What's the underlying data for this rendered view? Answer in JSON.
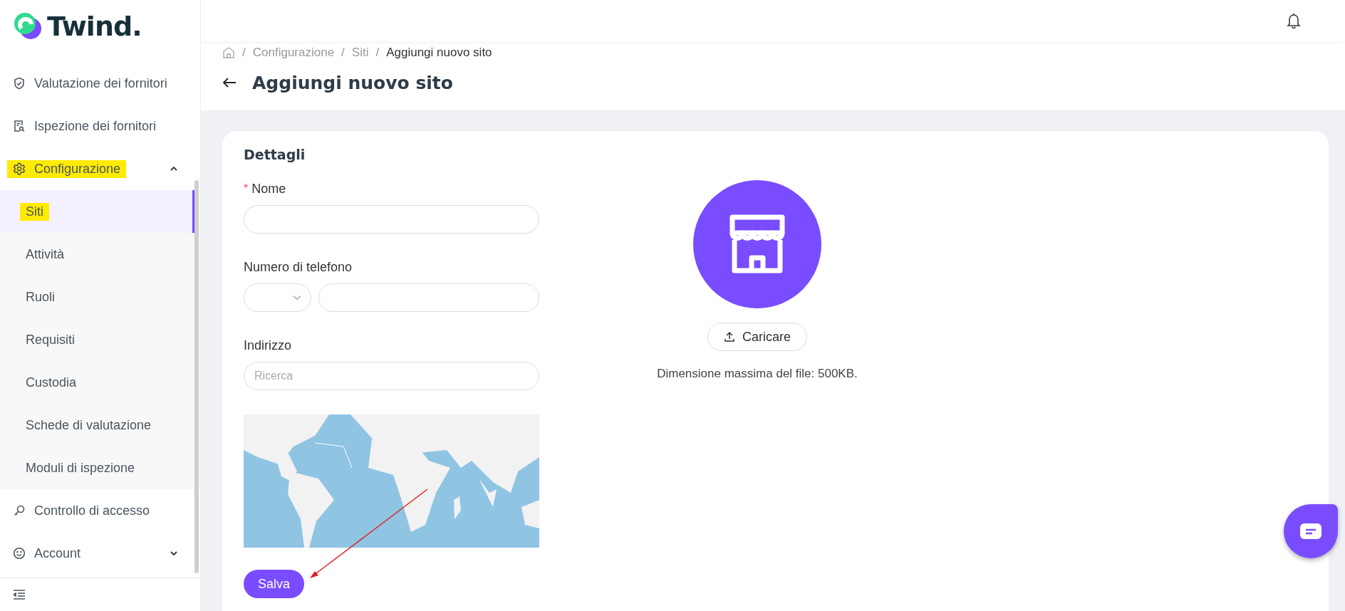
{
  "logo": {
    "text": "Twind."
  },
  "sidebar": {
    "items": [
      {
        "label": "Valutazione dei fornitori",
        "highlighted": false
      },
      {
        "label": "Ispezione dei fornitori",
        "highlighted": false
      },
      {
        "label": "Configurazione",
        "highlighted": true,
        "expanded": true,
        "children": [
          {
            "label": "Siti",
            "selected": true,
            "highlighted": true
          },
          {
            "label": "Attività",
            "selected": false,
            "highlighted": false
          },
          {
            "label": "Ruoli",
            "selected": false,
            "highlighted": false
          },
          {
            "label": "Requisiti",
            "selected": false,
            "highlighted": false
          },
          {
            "label": "Custodia",
            "selected": false,
            "highlighted": false
          },
          {
            "label": "Schede di valutazione",
            "selected": false,
            "highlighted": false
          },
          {
            "label": "Moduli di ispezione",
            "selected": false,
            "highlighted": false
          }
        ]
      },
      {
        "label": "Controllo di accesso",
        "highlighted": false
      },
      {
        "label": "Account",
        "highlighted": false,
        "expanded": false
      }
    ]
  },
  "breadcrumb": {
    "separator": "/",
    "items": [
      "Configurazione",
      "Siti",
      "Aggiungi nuovo sito"
    ]
  },
  "page_title": "Aggiungi nuovo sito",
  "card": {
    "section_title": "Dettagli",
    "fields": [
      {
        "kind": "text",
        "label": "Nome",
        "required_mark": "*"
      },
      {
        "kind": "phone",
        "label": "Numero di telefono"
      },
      {
        "kind": "search",
        "label": "Indirizzo",
        "placeholder": "Ricerca"
      }
    ],
    "save_button": "Salva",
    "upload_button": "Caricare",
    "upload_hint": "Dimensione massima del file: 500KB."
  }
}
